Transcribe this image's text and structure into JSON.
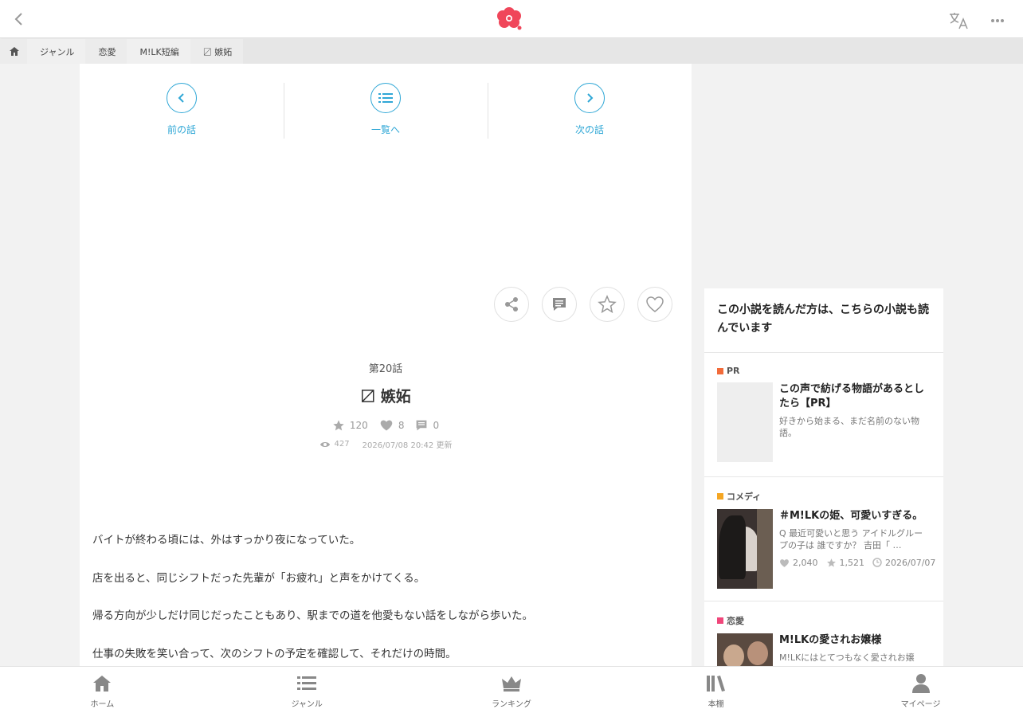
{
  "header": {
    "back_icon": "chevron-left-icon",
    "logo_icon": "flower-logo",
    "translate_icon": "translate-icon",
    "more_icon": "more-icon"
  },
  "breadcrumb": {
    "items": [
      "ジャンル",
      "恋愛",
      "M!LK短編",
      "〼 嫉妬"
    ]
  },
  "episode_nav": {
    "prev_label": "前の話",
    "list_label": "一覧へ",
    "next_label": "次の話"
  },
  "episode": {
    "number": "第20話",
    "title": "〼 嫉妬",
    "stars": "120",
    "likes": "8",
    "comments": "0",
    "views": "427",
    "updated": "2026/07/08 20:42 更新"
  },
  "body": {
    "paragraphs": [
      "バイトが終わる頃には、外はすっかり夜になっていた。",
      "店を出ると、同じシフトだった先輩が「お疲れ」と声をかけてくる。",
      "帰る方向が少しだけ同じだったこともあり、駅までの道を他愛もない話をしながら歩いた。",
      "仕事の失敗を笑い合って、次のシフトの予定を確認して、それだけの時間。"
    ]
  },
  "sidebar": {
    "heading": "この小説を読んだ方は、こちらの小説も読んでいます",
    "recs": [
      {
        "category": "PR",
        "category_color": "#f26b3a",
        "title": "この声で紡げる物語があるとしたら【PR】",
        "desc": "好きから始まる、まだ名前のない物語。",
        "likes": "",
        "stars": "",
        "date": ""
      },
      {
        "category": "コメディ",
        "category_color": "#f5a623",
        "title": "＃M!LKの姫、可愛いすぎる。",
        "desc": "Q 最近可愛いと思う アイドルグループの子は 誰ですか？ 吉田「 …",
        "likes": "2,040",
        "stars": "1,521",
        "date": "2026/07/07"
      },
      {
        "category": "恋愛",
        "category_color": "#f0467a",
        "title": "M!LKの愛されお嬢様",
        "desc": "M!LKにはとてつもなく愛されお嬢",
        "likes": "",
        "stars": "",
        "date": ""
      }
    ]
  },
  "bottom_nav": {
    "home": "ホーム",
    "genre": "ジャンル",
    "ranking": "ランキング",
    "bookshelf": "本棚",
    "mypage": "マイページ"
  },
  "colors": {
    "accent": "#2fa7d6",
    "logo": "#f0465a"
  }
}
